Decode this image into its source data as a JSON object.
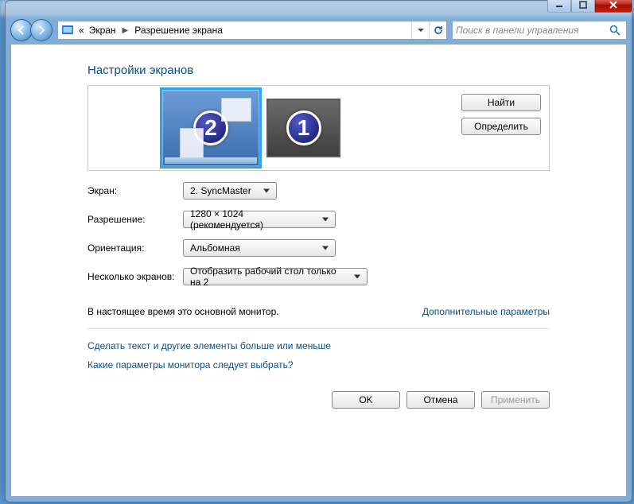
{
  "breadcrumb": {
    "root_symbol": "«",
    "item1": "Экран",
    "item2": "Разрешение экрана"
  },
  "search": {
    "placeholder": "Поиск в панели управления"
  },
  "page": {
    "title": "Настройки экранов",
    "find_btn": "Найти",
    "identify_btn": "Определить"
  },
  "monitors": {
    "primary_num": "2",
    "secondary_num": "1"
  },
  "form": {
    "display_label": "Экран:",
    "display_value": "2. SyncMaster",
    "resolution_label": "Разрешение:",
    "resolution_value": "1280 × 1024 (рекомендуется)",
    "orientation_label": "Ориентация:",
    "orientation_value": "Альбомная",
    "multi_label": "Несколько экранов:",
    "multi_value": "Отобразить рабочий стол только на 2"
  },
  "note_text": "В настоящее время это основной монитор.",
  "adv_link": "Дополнительные параметры",
  "link_textsize": "Сделать текст и другие элементы больше или меньше",
  "link_help": "Какие параметры монитора следует выбрать?",
  "buttons": {
    "ok": "OK",
    "cancel": "Отмена",
    "apply": "Применить"
  }
}
